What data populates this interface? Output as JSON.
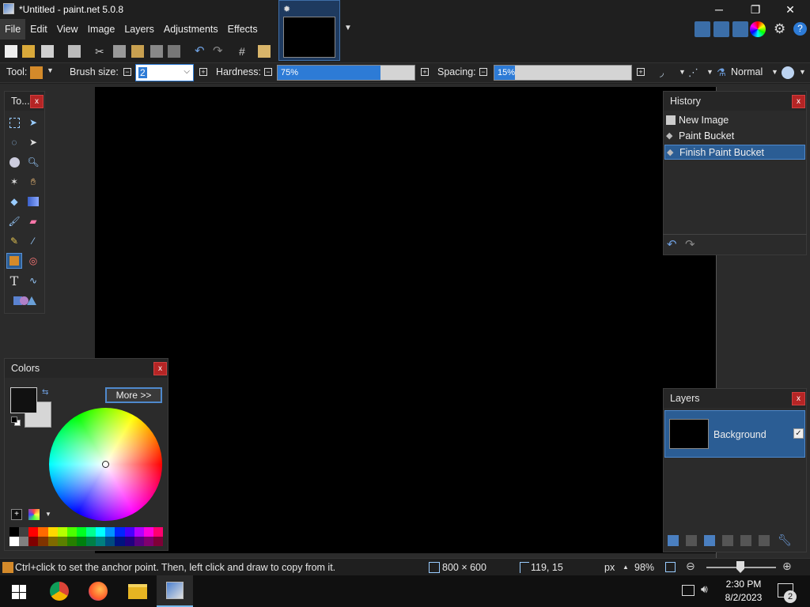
{
  "window": {
    "title": "*Untitled - paint.net 5.0.8",
    "minimize": "─",
    "restore": "❐",
    "close": "✕"
  },
  "menu": [
    "File",
    "Edit",
    "View",
    "Image",
    "Layers",
    "Adjustments",
    "Effects"
  ],
  "tool_options": {
    "tool_label": "Tool:",
    "brush_size_label": "Brush size:",
    "brush_size_value": "2",
    "hardness_label": "Hardness:",
    "hardness_value": "75%",
    "hardness_fraction": 0.75,
    "spacing_label": "Spacing:",
    "spacing_value": "15%",
    "spacing_fraction": 0.15,
    "blend_mode": "Normal"
  },
  "tools_panel": {
    "title": "To...",
    "close": "x"
  },
  "history_panel": {
    "title": "History",
    "close": "x",
    "items": [
      "New Image",
      "Paint Bucket",
      "Finish Paint Bucket"
    ],
    "selected_index": 2
  },
  "colors_panel": {
    "title": "Colors",
    "close": "x",
    "more_button": "More >>"
  },
  "layers_panel": {
    "title": "Layers",
    "close": "x",
    "layer_name": "Background"
  },
  "status": {
    "hint": "Ctrl+click to set the anchor point. Then, left click and draw to copy from it.",
    "image_size": "800 × 600",
    "cursor_pos": "119, 15",
    "unit": "px",
    "zoom": "98%"
  },
  "taskbar": {
    "time": "2:30 PM",
    "date": "8/2/2023",
    "notifications": "2"
  },
  "colors": {
    "accent": "#2b5d94",
    "close_red": "#b52525",
    "canvas": "#000000"
  }
}
